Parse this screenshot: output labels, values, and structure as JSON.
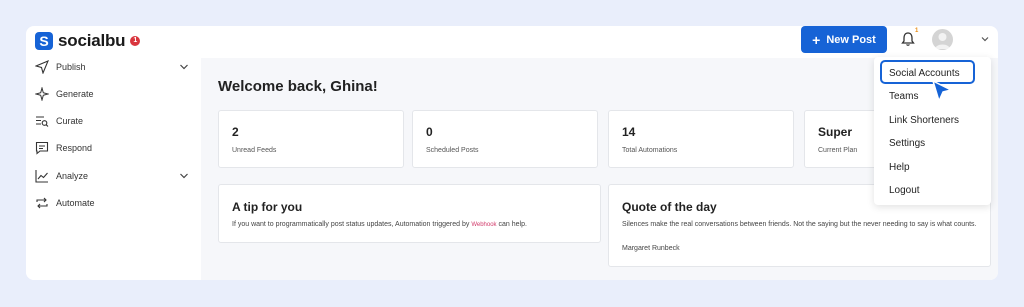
{
  "app": {
    "name": "socialbu",
    "badge": "1"
  },
  "header": {
    "new_post_label": "New Post",
    "notification_badge": "1"
  },
  "sidebar": {
    "items": [
      {
        "label": "Publish",
        "icon": "send-icon",
        "has_chevron": true
      },
      {
        "label": "Generate",
        "icon": "sparkle-icon",
        "has_chevron": false
      },
      {
        "label": "Curate",
        "icon": "curate-icon",
        "has_chevron": false
      },
      {
        "label": "Respond",
        "icon": "message-icon",
        "has_chevron": false
      },
      {
        "label": "Analyze",
        "icon": "chart-line-icon",
        "has_chevron": true
      },
      {
        "label": "Automate",
        "icon": "repeat-icon",
        "has_chevron": false
      }
    ]
  },
  "main": {
    "welcome": "Welcome back, Ghina!",
    "stats": [
      {
        "value": "2",
        "caption": "Unread Feeds"
      },
      {
        "value": "0",
        "caption": "Scheduled Posts"
      },
      {
        "value": "14",
        "caption": "Total Automations"
      },
      {
        "value": "Super",
        "caption": "Current Plan"
      }
    ],
    "tip": {
      "title": "A tip for you",
      "text_before": "If you want to programmatically post status updates, Automation triggered by",
      "link": "Webhook",
      "text_after": "can help."
    },
    "quote": {
      "title": "Quote of the day",
      "text": "Silences make the real conversations between friends. Not the saying but the never needing to say is what counts.",
      "author": "Margaret Runbeck"
    }
  },
  "dropdown": {
    "items": [
      "Social Accounts",
      "Teams",
      "Link Shorteners",
      "Settings",
      "Help",
      "Logout"
    ]
  },
  "colors": {
    "brand": "#1663d6",
    "badge": "#d9363e",
    "webhook_link": "#d23b6b",
    "background": "#e9eefb"
  }
}
